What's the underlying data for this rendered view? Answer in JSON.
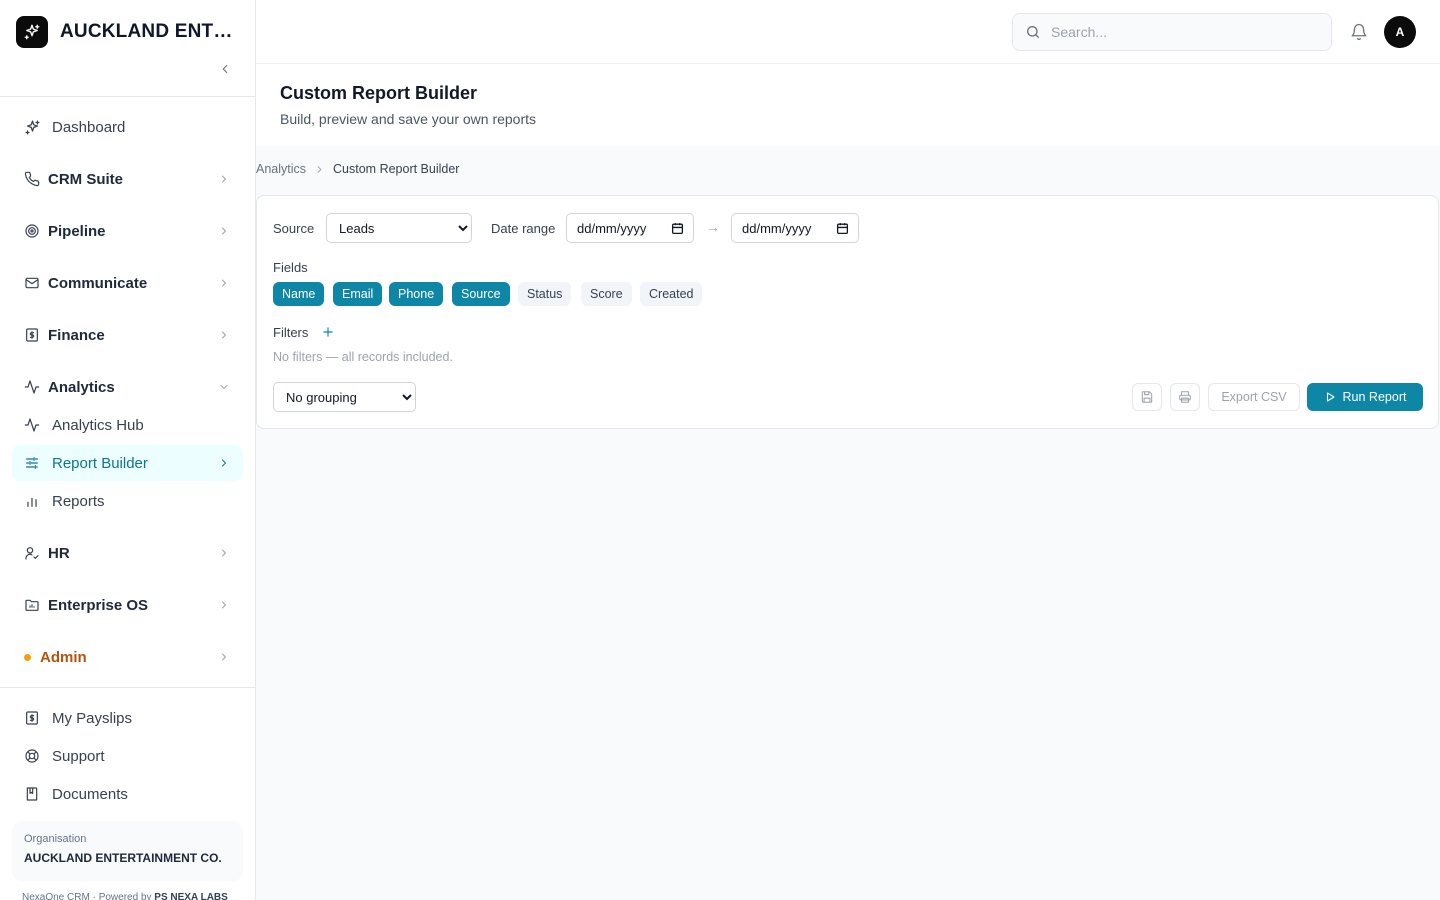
{
  "app": {
    "brand": "AUCKLAND ENTERTAINMENT CO.",
    "organisation_label": "Organisation",
    "organisation_name": "AUCKLAND ENTERTAINMENT CO.",
    "footer_app": "NexaOne CRM",
    "footer_powered": "Powered by",
    "footer_company": "PS NEXA LABS"
  },
  "nav": {
    "dashboard": "Dashboard",
    "crm_suite": "CRM Suite",
    "pipeline": "Pipeline",
    "communicate": "Communicate",
    "finance": "Finance",
    "analytics": "Analytics",
    "analytics_hub": "Analytics Hub",
    "report_builder": "Report Builder",
    "reports": "Reports",
    "hr": "HR",
    "enterprise_os": "Enterprise OS",
    "admin": "Admin",
    "my_payslips": "My Payslips",
    "support": "Support",
    "documents": "Documents"
  },
  "topbar": {
    "search_placeholder": "Search...",
    "avatar_initial": "A"
  },
  "page": {
    "title": "Custom Report Builder",
    "subtitle": "Build, preview and save your own reports"
  },
  "breadcrumb": {
    "parent": "Analytics",
    "current": "Custom Report Builder"
  },
  "builder": {
    "source_label": "Source",
    "source_value": "Leads",
    "source_options": [
      "Leads"
    ],
    "date_range_label": "Date range",
    "date_from_placeholder": "dd/mm/yyyy",
    "date_arrow": "→",
    "date_to_placeholder": "dd/mm/yyyy",
    "fields_label": "Fields",
    "fields": [
      {
        "label": "Name",
        "selected": true
      },
      {
        "label": "Email",
        "selected": true
      },
      {
        "label": "Phone",
        "selected": true
      },
      {
        "label": "Source",
        "selected": true
      },
      {
        "label": "Status",
        "selected": false
      },
      {
        "label": "Score",
        "selected": false
      },
      {
        "label": "Created",
        "selected": false
      }
    ],
    "filters_label": "Filters",
    "filters_empty": "No filters — all records included.",
    "grouping_value": "No grouping",
    "grouping_options": [
      "No grouping"
    ],
    "export_label": "Export CSV",
    "run_label": "Run Report"
  },
  "colors": {
    "accent": "#0e87a6",
    "active_bg": "#ecfeff",
    "admin": "#b45309"
  }
}
